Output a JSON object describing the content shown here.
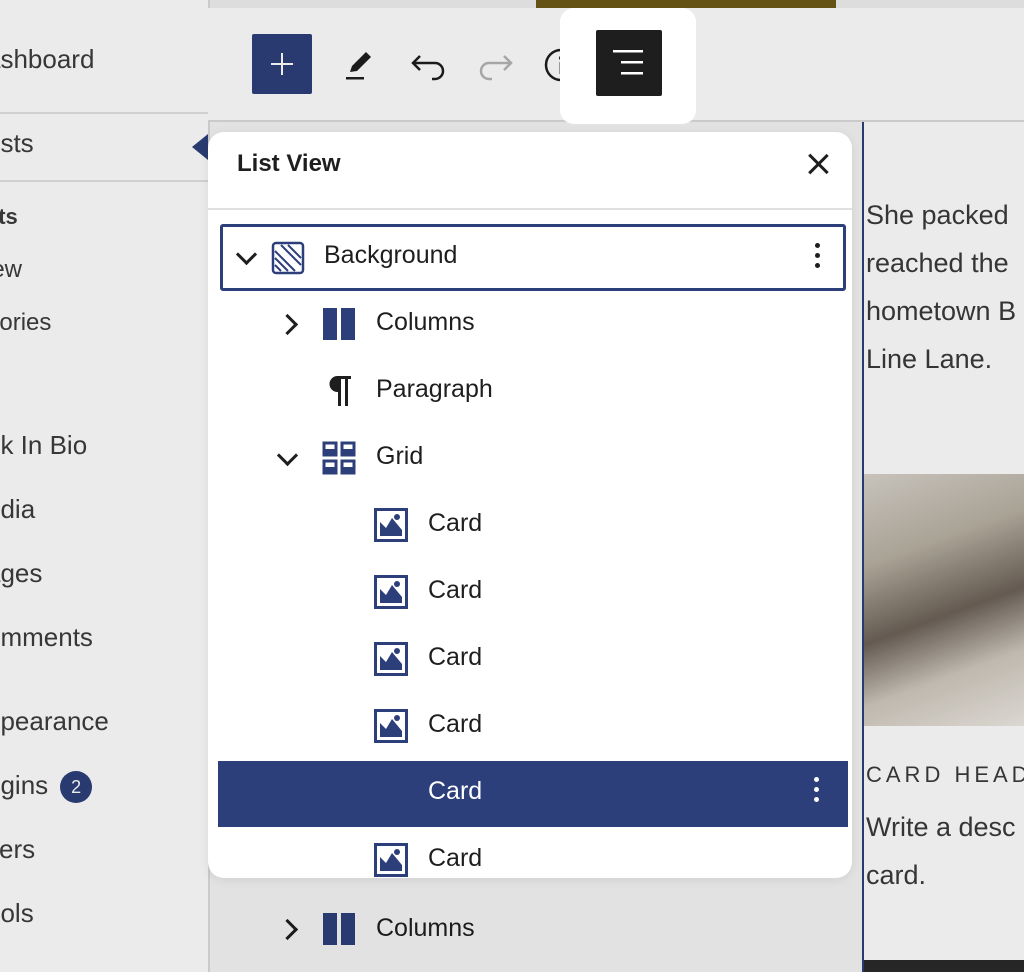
{
  "sidebar": {
    "items": [
      {
        "label": "ashboard"
      },
      {
        "label": "osts"
      },
      {
        "label": "sts"
      },
      {
        "label": "lew"
      },
      {
        "label": "gories"
      },
      {
        "label": "nk In Bio"
      },
      {
        "label": "edia"
      },
      {
        "label": "ages"
      },
      {
        "label": "omments"
      },
      {
        "label": "ppearance"
      },
      {
        "label": "ugins"
      },
      {
        "label": "sers"
      },
      {
        "label": "ools"
      }
    ],
    "plugins_badge": "2"
  },
  "toolbar": {
    "add_label": "Add block",
    "edit_label": "Edit",
    "undo_label": "Undo",
    "redo_label": "Redo",
    "info_label": "Details",
    "list_view_label": "List View"
  },
  "list_view": {
    "title": "List View",
    "rows": [
      {
        "label": "Background",
        "icon": "cover-icon",
        "expanded": true
      },
      {
        "label": "Columns",
        "icon": "columns-icon",
        "expanded": false
      },
      {
        "label": "Paragraph",
        "icon": "paragraph-icon"
      },
      {
        "label": "Grid",
        "icon": "grid-icon",
        "expanded": true
      },
      {
        "label": "Card",
        "icon": "image-icon"
      },
      {
        "label": "Card",
        "icon": "image-icon"
      },
      {
        "label": "Card",
        "icon": "image-icon"
      },
      {
        "label": "Card",
        "icon": "image-icon"
      },
      {
        "label": "Card",
        "icon": "image-icon",
        "selected": true
      },
      {
        "label": "Card",
        "icon": "image-icon"
      }
    ]
  },
  "below_panel": {
    "columns_label": "Columns"
  },
  "canvas": {
    "lines": [
      "She packed",
      "reached the",
      "hometown B",
      "Line Lane."
    ],
    "card_heading": "CARD HEAD",
    "card_text": [
      "Write a desc",
      "card."
    ]
  },
  "colors": {
    "accent": "#2d3f7a",
    "dark": "#1e1e1e",
    "gold": "#6d5a17"
  }
}
